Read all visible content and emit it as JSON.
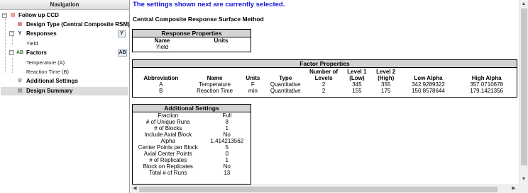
{
  "navigation": {
    "title": "Navigation",
    "items": [
      {
        "label": "Follow up CCD"
      },
      {
        "label": "Design Type (Central Composite RSM)"
      },
      {
        "label": "Responses"
      },
      {
        "label": "Yield"
      },
      {
        "label": "Factors"
      },
      {
        "label": "Temperature (A)"
      },
      {
        "label": "Reaction Time (B)"
      },
      {
        "label": "Additional Settings"
      },
      {
        "label": "Design Summary"
      }
    ],
    "responses_button": "Y",
    "factors_button": "AB"
  },
  "content": {
    "notice": "The settings shown next are currently selected.",
    "method_title": "Central Composite Response Surface Method",
    "response_properties": {
      "title": "Response Properties",
      "headers": [
        "Name",
        "Units"
      ],
      "rows": [
        [
          "Yield",
          ""
        ]
      ]
    },
    "factor_properties": {
      "title": "Factor Properties",
      "headers": [
        "Abbreviation",
        "Name",
        "Units",
        "Type",
        "Number of Levels",
        "Level 1 (Low)",
        "Level 2 (High)",
        "Low Alpha",
        "High Alpha"
      ],
      "rows": [
        [
          "A",
          "Temperature",
          "F",
          "Quantitative",
          "2",
          "345",
          "355",
          "342.9289322",
          "357.0710678"
        ],
        [
          "B",
          "Reaction Time",
          "min",
          "Quantitative",
          "2",
          "155",
          "175",
          "150.8578644",
          "179.1421356"
        ]
      ]
    },
    "additional_settings": {
      "title": "Additional Settings",
      "rows": [
        [
          "Fraction",
          "Full"
        ],
        [
          "# of Unique Runs",
          "8"
        ],
        [
          "# of Blocks",
          "1"
        ],
        [
          "Include Axial Block",
          "No"
        ],
        [
          "Alpha",
          "1.414213562"
        ],
        [
          "Center Points per Block",
          "5"
        ],
        [
          "Axial Center Points",
          "0"
        ],
        [
          "# of Replicates",
          "1"
        ],
        [
          "Block on Replicates",
          "No"
        ],
        [
          "Total # of Runs",
          "13"
        ]
      ]
    }
  }
}
